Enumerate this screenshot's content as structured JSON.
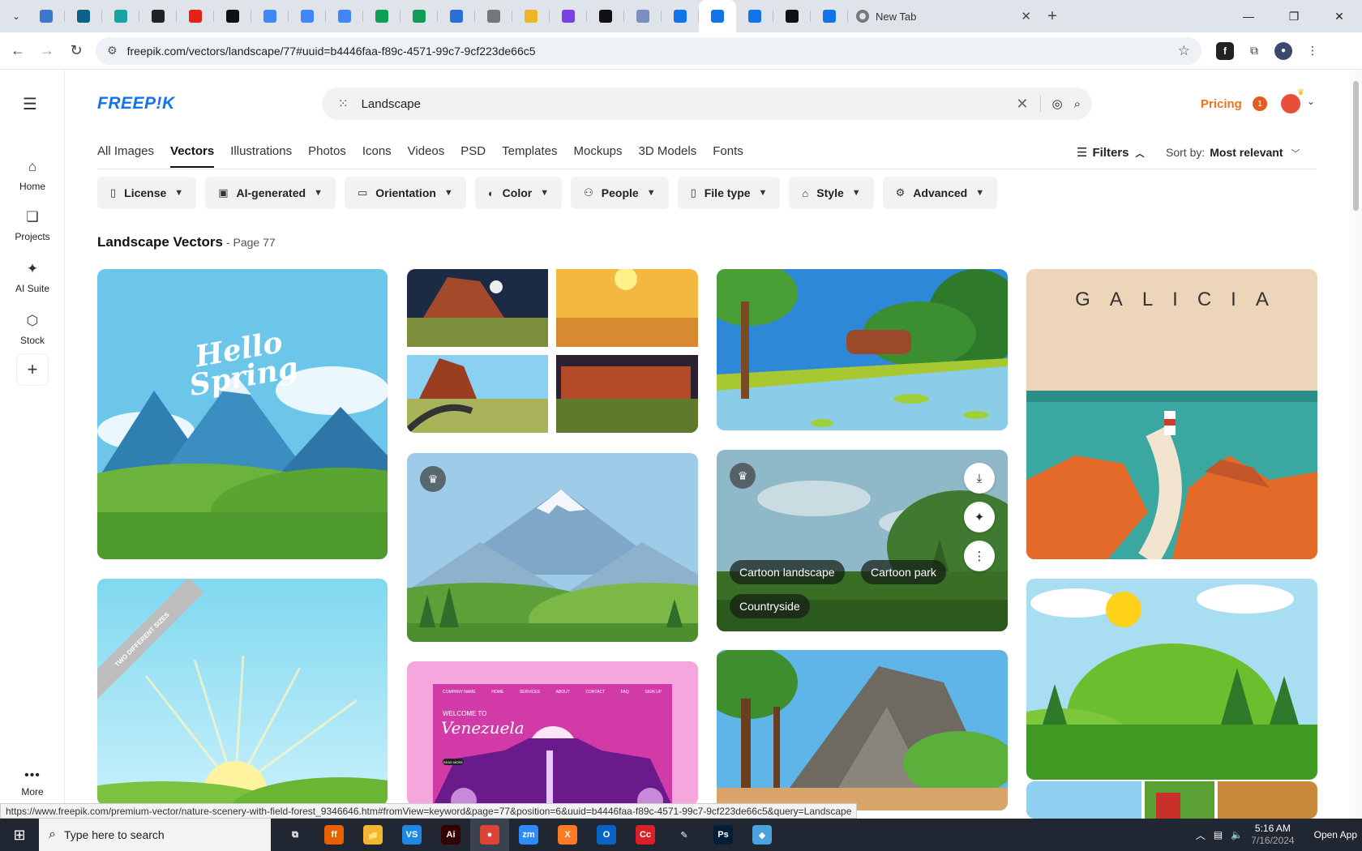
{
  "browser": {
    "tabs": [
      {
        "name": "tab-1",
        "color": "#3d78c9"
      },
      {
        "name": "tab-2",
        "color": "#0e5f8a"
      },
      {
        "name": "tab-3",
        "color": "#1aa3a3"
      },
      {
        "name": "tab-4",
        "color": "#222222"
      },
      {
        "name": "tab-5",
        "color": "#e62117"
      },
      {
        "name": "tab-6",
        "color": "#111111"
      },
      {
        "name": "tab-7",
        "color": "#4285f4"
      },
      {
        "name": "tab-8",
        "color": "#4285f4"
      },
      {
        "name": "tab-9",
        "color": "#4285f4"
      },
      {
        "name": "tab-10",
        "color": "#0f9d58"
      },
      {
        "name": "tab-11",
        "color": "#0f9d58"
      },
      {
        "name": "tab-12",
        "color": "#2b6fd6"
      },
      {
        "name": "tab-13",
        "color": "#777777"
      },
      {
        "name": "tab-14",
        "color": "#f0b429"
      },
      {
        "name": "tab-15",
        "color": "#7b3fe4"
      },
      {
        "name": "tab-16",
        "color": "#111111"
      },
      {
        "name": "tab-17",
        "color": "#7a90c4"
      },
      {
        "name": "tab-18",
        "color": "#1273eb"
      },
      {
        "name": "tab-19",
        "color": "#1273eb"
      },
      {
        "name": "tab-20",
        "color": "#1273eb"
      },
      {
        "name": "tab-21",
        "color": "#111111"
      },
      {
        "name": "tab-22",
        "color": "#1273eb"
      }
    ],
    "new_tab_title": "New Tab",
    "url": "freepik.com/vectors/landscape/77#uuid=b4446faa-f89c-4571-99c7-9cf223de66c5",
    "status_url": "https://www.freepik.com/premium-vector/nature-scenery-with-field-forest_9346646.htm#fromView=keyword&page=77&position=6&uuid=b4446faa-f89c-4571-99c7-9cf223de66c5&query=Landscape"
  },
  "sidebar": {
    "items": [
      {
        "label": "Home"
      },
      {
        "label": "Projects"
      },
      {
        "label": "AI Suite"
      },
      {
        "label": "Stock"
      }
    ],
    "more_label": "More"
  },
  "header": {
    "logo": "FREEP!K",
    "search_value": "Landscape",
    "pricing": "Pricing",
    "notif_count": "1"
  },
  "categories": [
    "All Images",
    "Vectors",
    "Illustrations",
    "Photos",
    "Icons",
    "Videos",
    "PSD",
    "Templates",
    "Mockups",
    "3D Models",
    "Fonts"
  ],
  "active_category": "Vectors",
  "toolbar": {
    "filters_label": "Filters",
    "sort_label": "Sort by:",
    "sort_value": "Most relevant"
  },
  "chips": [
    "License",
    "AI-generated",
    "Orientation",
    "Color",
    "People",
    "File type",
    "Style",
    "Advanced"
  ],
  "results": {
    "title": "Landscape Vectors",
    "page": "- Page 77"
  },
  "cards": {
    "spring_text": "Hello\nSpring",
    "galicia_text": "GALICIA",
    "ribbon_text": "TWO DIFFERENT SIZES",
    "venezuela": {
      "brand": "COMPANY NAME",
      "nav": [
        "HOME",
        "SERVICES",
        "ABOUT",
        "CONTACT",
        "FAQ",
        "SIGN UP"
      ],
      "welcome": "WELCOME TO",
      "title": "Venezuela",
      "button": "READ MORE"
    },
    "hover_tags": [
      "Cartoon landscape",
      "Cartoon park",
      "Countryside"
    ]
  },
  "taskbar": {
    "search_placeholder": "Type here to search",
    "time": "5:16 AM",
    "date": "7/16/2024",
    "open_app": "Open App",
    "apps": [
      {
        "name": "task-view",
        "label": "⧉",
        "color": "#202732"
      },
      {
        "name": "firefox",
        "label": "ff",
        "color": "#e66000"
      },
      {
        "name": "file-explorer",
        "label": "📁",
        "color": "#f2b632"
      },
      {
        "name": "vscode",
        "label": "VS",
        "color": "#1e88e5"
      },
      {
        "name": "illustrator",
        "label": "Ai",
        "color": "#330000"
      },
      {
        "name": "chrome",
        "label": "●",
        "color": "#db4437"
      },
      {
        "name": "zoom",
        "label": "zm",
        "color": "#2d8cff"
      },
      {
        "name": "xampp",
        "label": "X",
        "color": "#fb7a24"
      },
      {
        "name": "outlook",
        "label": "O",
        "color": "#0a64c8"
      },
      {
        "name": "creative-cloud",
        "label": "Cc",
        "color": "#da1f26"
      },
      {
        "name": "pen-tool",
        "label": "✎",
        "color": "#202732"
      },
      {
        "name": "photoshop",
        "label": "Ps",
        "color": "#001e36"
      },
      {
        "name": "app-blue",
        "label": "◆",
        "color": "#4aa3df"
      }
    ]
  }
}
